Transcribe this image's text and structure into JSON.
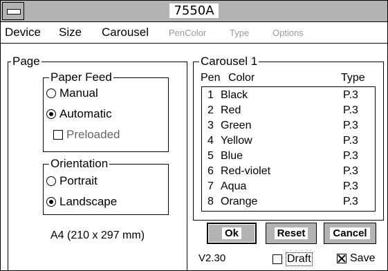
{
  "window": {
    "title": "7550A"
  },
  "menu": {
    "device": "Device",
    "size": "Size",
    "carousel": "Carousel",
    "pencolor": "PenColor",
    "type": "Type",
    "options": "Options"
  },
  "page_group": {
    "label": "Page",
    "paper_feed": {
      "label": "Paper Feed",
      "manual": "Manual",
      "automatic": "Automatic",
      "preloaded": "Preloaded",
      "selected": "automatic",
      "preloaded_checked": false
    },
    "orientation": {
      "label": "Orientation",
      "portrait": "Portrait",
      "landscape": "Landscape",
      "selected": "landscape"
    },
    "paper_size": "A4 (210 x 297 mm)"
  },
  "carousel_group": {
    "label": "Carousel 1",
    "col_pen": "Pen",
    "col_color": "Color",
    "col_type": "Type",
    "pens": [
      {
        "num": "1",
        "color": "Black",
        "type": "P.3"
      },
      {
        "num": "2",
        "color": "Red",
        "type": "P.3"
      },
      {
        "num": "3",
        "color": "Green",
        "type": "P.3"
      },
      {
        "num": "4",
        "color": "Yellow",
        "type": "P.3"
      },
      {
        "num": "5",
        "color": "Blue",
        "type": "P.3"
      },
      {
        "num": "6",
        "color": "Red-violet",
        "type": "P.3"
      },
      {
        "num": "7",
        "color": "Aqua",
        "type": "P.3"
      },
      {
        "num": "8",
        "color": "Orange",
        "type": "P.3"
      }
    ]
  },
  "buttons": {
    "ok": "Ok",
    "reset": "Reset",
    "cancel": "Cancel"
  },
  "footer": {
    "version": "V2.30",
    "draft": "Draft",
    "draft_checked": false,
    "save": "Save",
    "save_checked": true
  }
}
